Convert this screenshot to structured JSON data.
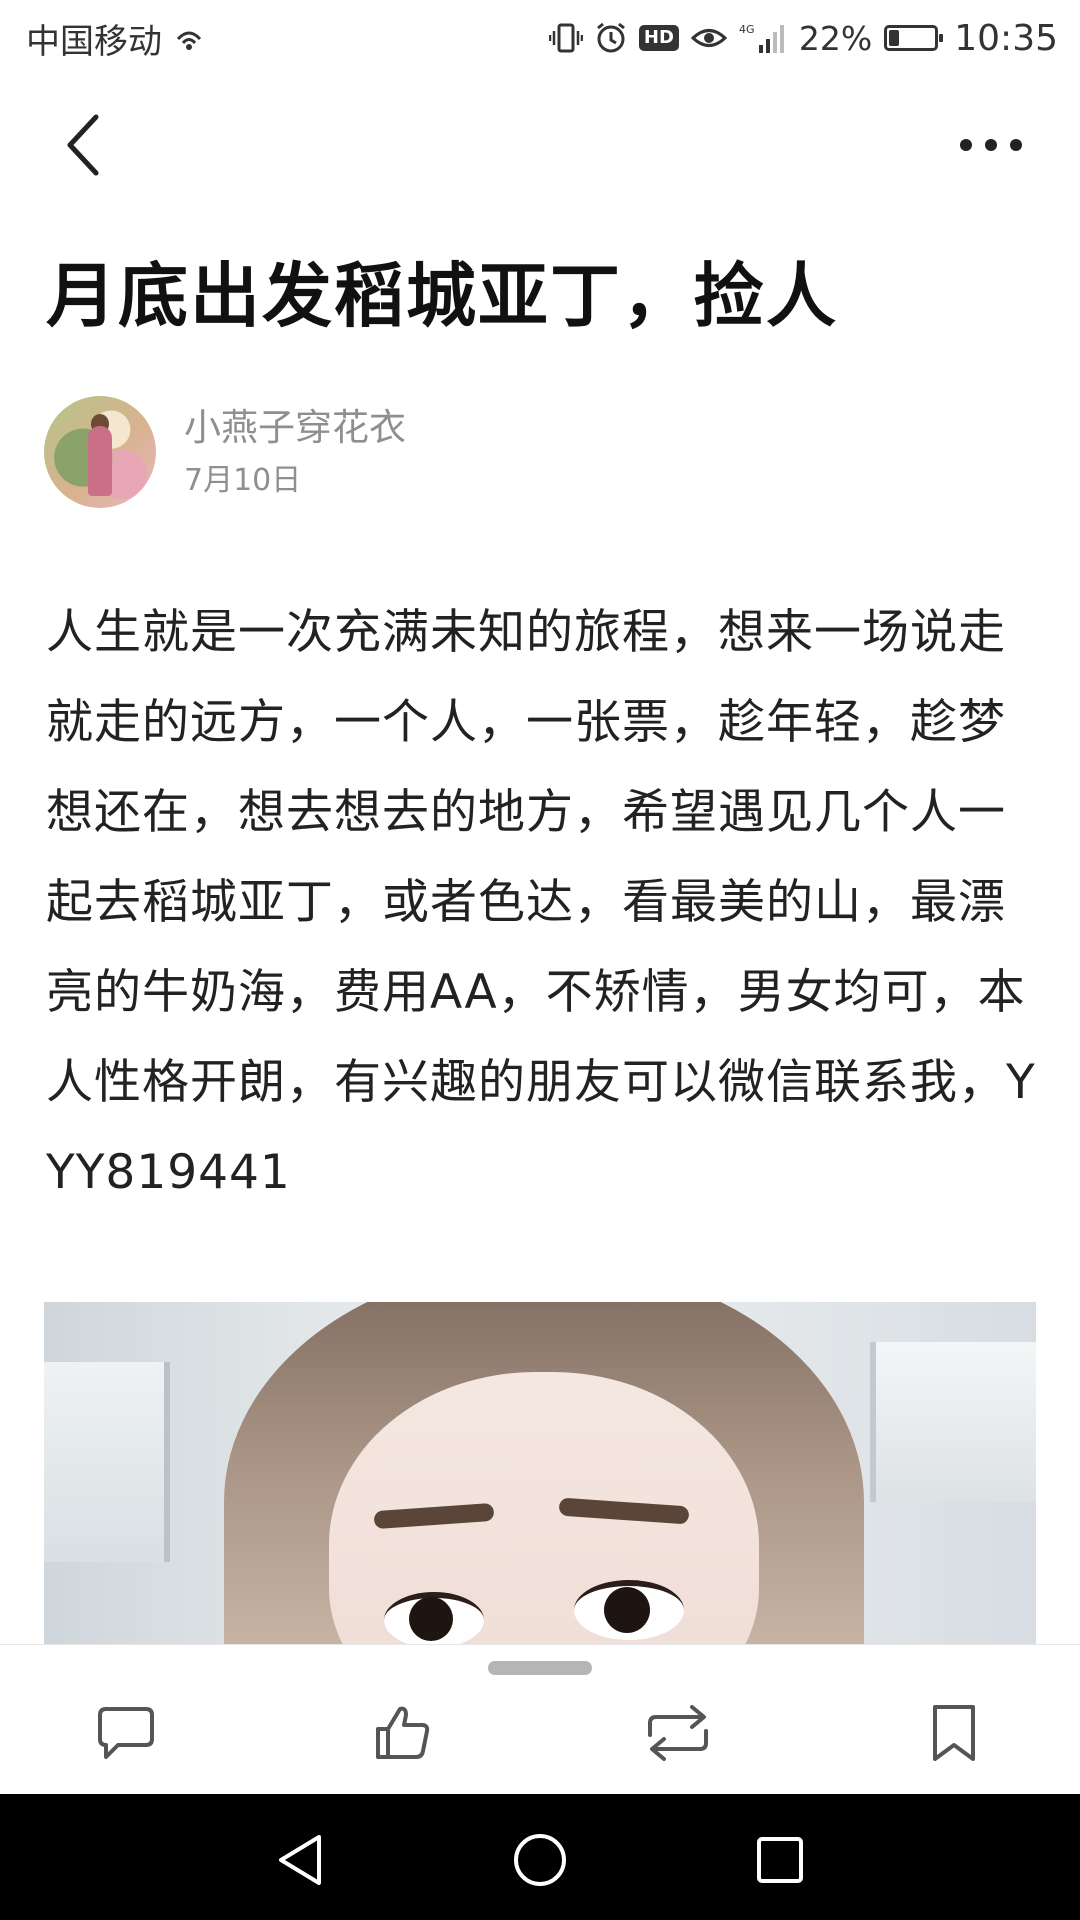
{
  "status_bar": {
    "carrier": "中国移动",
    "network": "4G",
    "battery_percent": "22%",
    "battery_level": 0.22,
    "time": "10:35",
    "icons": [
      "wifi-call-icon",
      "vibrate-icon",
      "alarm-icon",
      "hd-icon",
      "eye-comfort-icon",
      "signal-icon",
      "battery-icon"
    ],
    "hd_label": "HD"
  },
  "toolbar": {
    "back_icon": "chevron-left-icon",
    "more_icon": "more-dots-icon"
  },
  "post": {
    "title": "月底出发稻城亚丁，捡人",
    "author": "小燕子穿花衣",
    "date": "7月10日",
    "body": "人生就是一次充满未知的旅程，想来一场说走就走的远方，一个人，一张票，趁年轻，趁梦想还在，想去想去的地方，希望遇见几个人一起去稻城亚丁，或者色达，看最美的山，最漂亮的牛奶海，费用AA，不矫情，男女均可，本人性格开朗，有兴趣的朋友可以微信联系我，YYY819441"
  },
  "actions": {
    "icons": [
      "comment-icon",
      "like-icon",
      "repost-icon",
      "bookmark-icon"
    ]
  },
  "nav": {
    "icons": [
      "back-triangle-icon",
      "home-circle-icon",
      "recent-square-icon"
    ]
  }
}
